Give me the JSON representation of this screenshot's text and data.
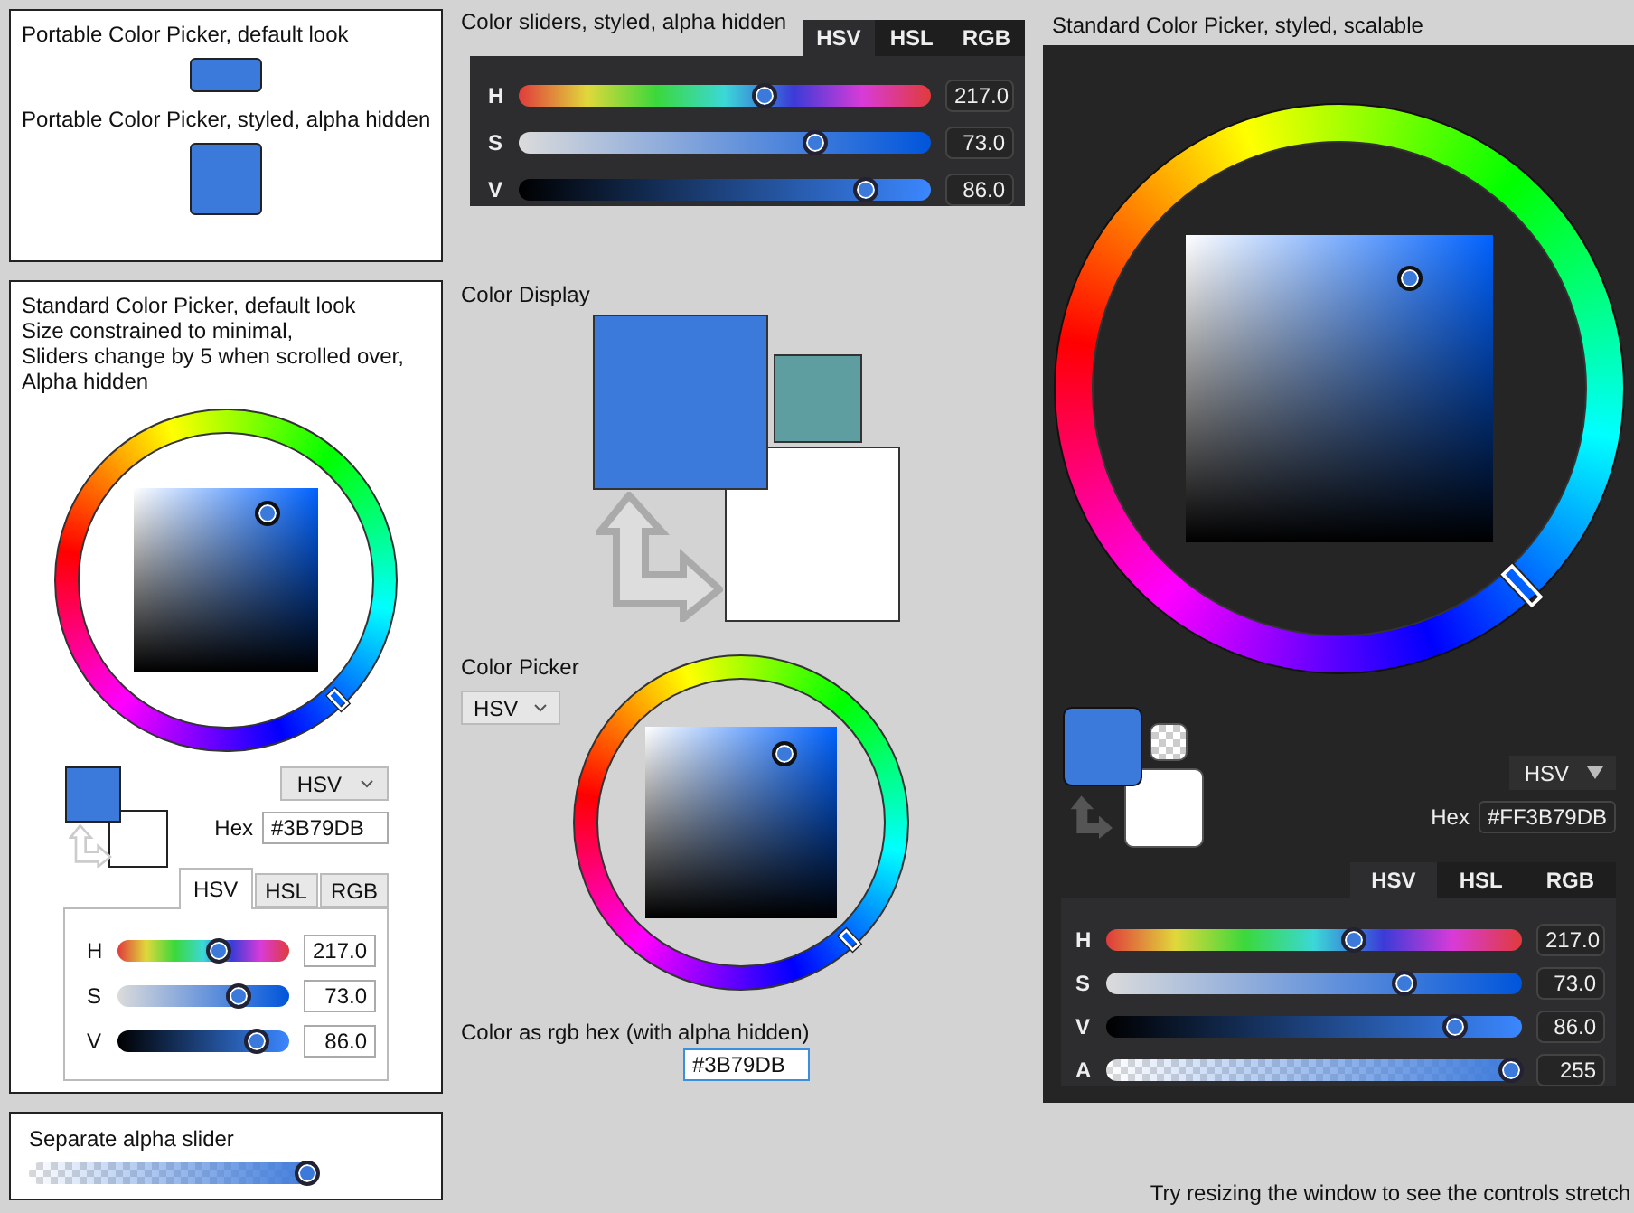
{
  "portable_pickers": {
    "default_title": "Portable Color Picker, default look",
    "styled_title": "Portable Color Picker, styled, alpha hidden"
  },
  "standard_picker": {
    "description": [
      "Standard Color Picker, default look",
      "Size constrained to minimal,",
      "Sliders change by 5 when scrolled over,",
      "Alpha hidden"
    ],
    "mode_dropdown": "HSV",
    "hex_label": "Hex",
    "hex_value": "#3B79DB",
    "tabs": [
      {
        "label": "HSV",
        "selected": true
      },
      {
        "label": "HSL",
        "selected": false
      },
      {
        "label": "RGB",
        "selected": false
      }
    ],
    "sliders": [
      {
        "kind": "hue",
        "label": "H",
        "value": "217.0",
        "level": 0.603
      },
      {
        "kind": "saturation",
        "label": "S",
        "value": "73.0",
        "level": 0.73
      },
      {
        "kind": "value",
        "label": "V",
        "value": "86.0",
        "level": 0.86
      }
    ]
  },
  "alpha_panel": {
    "title": "Separate alpha slider",
    "slider": {
      "kind": "alpha",
      "level": 1
    }
  },
  "styled_sliders": {
    "title": "Color sliders, styled, alpha hidden",
    "tabs": [
      {
        "label": "HSV",
        "selected": true
      },
      {
        "label": "HSL",
        "selected": false
      },
      {
        "label": "RGB",
        "selected": false
      }
    ],
    "sliders": [
      {
        "kind": "hue",
        "label": "H",
        "value": "217.0",
        "level": 0.603
      },
      {
        "kind": "saturation",
        "label": "S",
        "value": "73.0",
        "level": 0.73
      },
      {
        "kind": "value",
        "label": "V",
        "value": "86.0",
        "level": 0.86
      }
    ]
  },
  "color_display": {
    "title": "Color Display"
  },
  "color_picker": {
    "title": "Color Picker",
    "mode_dropdown": "HSV"
  },
  "hex_box": {
    "label": "Color as rgb hex (with alpha hidden)",
    "value": "#3B79DB"
  },
  "scalable_picker": {
    "title": "Standard Color Picker, styled, scalable",
    "mode_dropdown": "HSV",
    "hex_label": "Hex",
    "hex_value": "#FF3B79DB",
    "tabs": [
      {
        "label": "HSV",
        "selected": true
      },
      {
        "label": "HSL",
        "selected": false
      },
      {
        "label": "RGB",
        "selected": false
      }
    ],
    "sliders": [
      {
        "kind": "hue",
        "label": "H",
        "value": "217.0",
        "level": 0.603
      },
      {
        "kind": "saturation",
        "label": "S",
        "value": "73.0",
        "level": 0.73
      },
      {
        "kind": "value",
        "label": "V",
        "value": "86.0",
        "level": 0.86
      },
      {
        "kind": "alpha",
        "label": "A",
        "value": "255",
        "level": 1
      }
    ]
  },
  "footer": "Try resizing the window to see the controls stretch"
}
